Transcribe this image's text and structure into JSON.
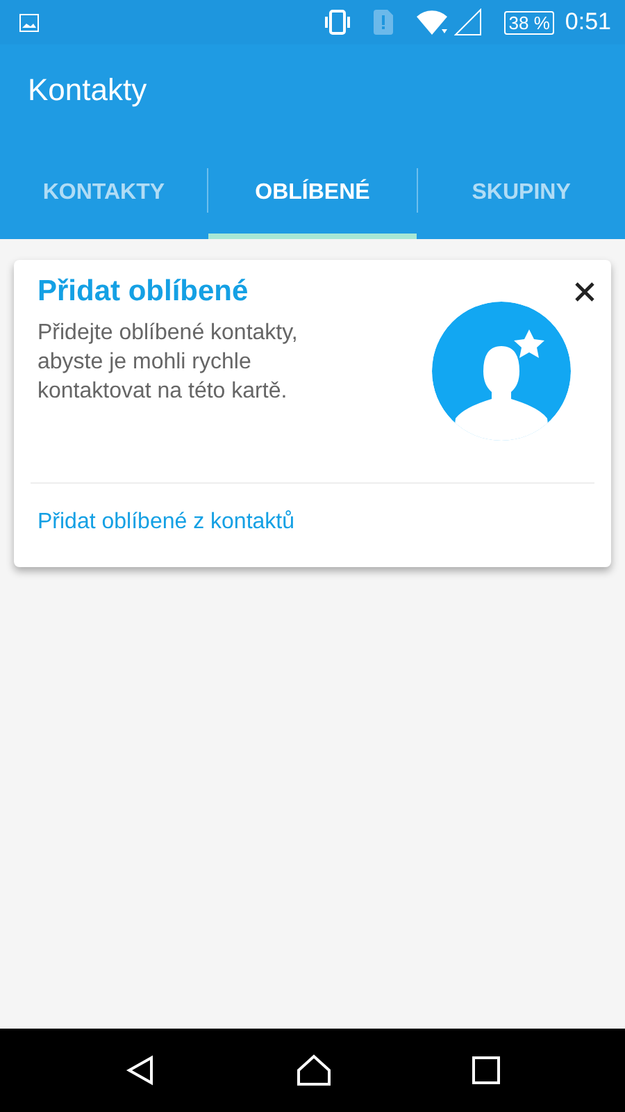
{
  "status_bar": {
    "battery": "38 %",
    "time": "0:51"
  },
  "app_bar": {
    "title": "Kontakty"
  },
  "tabs": [
    {
      "label": "KONTAKTY",
      "selected": false
    },
    {
      "label": "OBLÍBENÉ",
      "selected": true
    },
    {
      "label": "SKUPINY",
      "selected": false
    }
  ],
  "card": {
    "title": "Přidat oblíbené",
    "body": "Přidejte oblíbené kontakty, abyste je mohli rychle kontaktovat na této kartě.",
    "link": "Přidat oblíbené z kontaktů"
  }
}
